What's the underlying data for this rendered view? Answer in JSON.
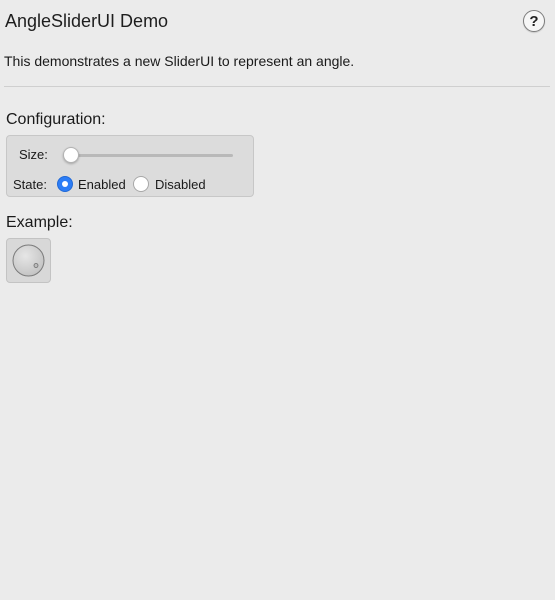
{
  "window": {
    "title": "AngleSliderUI Demo",
    "help_label": "?"
  },
  "description": "This demonstrates a new SliderUI to represent an angle.",
  "configuration": {
    "heading": "Configuration:",
    "size": {
      "label": "Size:",
      "value_fraction": 0.0
    },
    "state": {
      "label": "State:",
      "options": [
        "Enabled",
        "Disabled"
      ],
      "selected": "Enabled"
    }
  },
  "example": {
    "heading": "Example:",
    "dial_icon": "angle-dial-icon"
  },
  "colors": {
    "accent": "#2c7df6",
    "background": "#ebebeb",
    "panel": "#dcdcdc"
  }
}
